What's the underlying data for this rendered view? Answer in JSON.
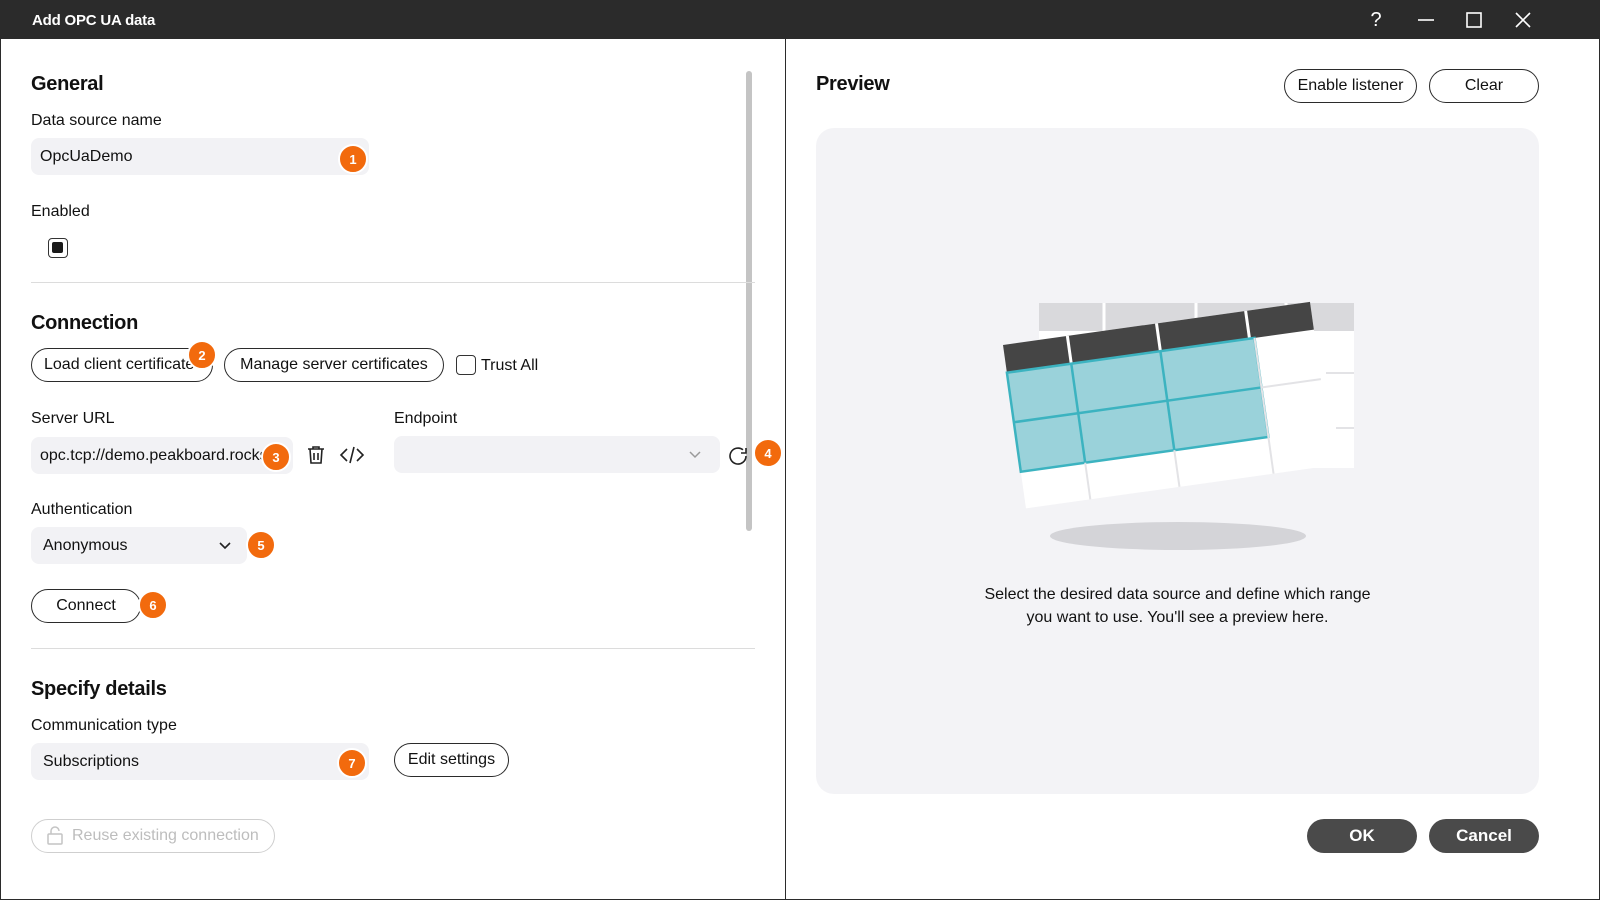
{
  "window": {
    "title": "Add OPC UA data",
    "help_glyph": "?"
  },
  "general": {
    "heading": "General",
    "name_label": "Data source name",
    "name_value": "OpcUaDemo",
    "enabled_label": "Enabled",
    "enabled": true
  },
  "connection": {
    "heading": "Connection",
    "load_cert_label": "Load client certificate",
    "manage_cert_label": "Manage server certificates",
    "trust_all_label": "Trust All",
    "trust_all": false,
    "server_url_label": "Server URL",
    "server_url_value": "opc.tcp://demo.peakboard.rocks",
    "endpoint_label": "Endpoint",
    "endpoint_value": "",
    "auth_label": "Authentication",
    "auth_value": "Anonymous",
    "connect_label": "Connect"
  },
  "details": {
    "heading": "Specify details",
    "comm_type_label": "Communication type",
    "comm_type_value": "Subscriptions",
    "edit_settings_label": "Edit settings"
  },
  "footer_left": {
    "reuse_label": "Reuse existing connection"
  },
  "preview": {
    "heading": "Preview",
    "enable_listener_label": "Enable listener",
    "clear_label": "Clear",
    "text_line1": "Select the desired data source and define which range",
    "text_line2": "you want to use. You'll see a preview here."
  },
  "footer": {
    "ok_label": "OK",
    "cancel_label": "Cancel"
  },
  "badges": [
    "1",
    "2",
    "3",
    "4",
    "5",
    "6",
    "7"
  ],
  "colors": {
    "accent": "#f26a0d",
    "titlebar": "#2b2b2b",
    "teal": "#9ad2da",
    "button_dark": "#4a4a4a"
  },
  "icons": [
    "help-icon",
    "minimize-icon",
    "maximize-icon",
    "close-icon",
    "trash-icon",
    "code-icon",
    "chevron-down-icon",
    "refresh-icon",
    "lock-icon",
    "table-illustration"
  ]
}
